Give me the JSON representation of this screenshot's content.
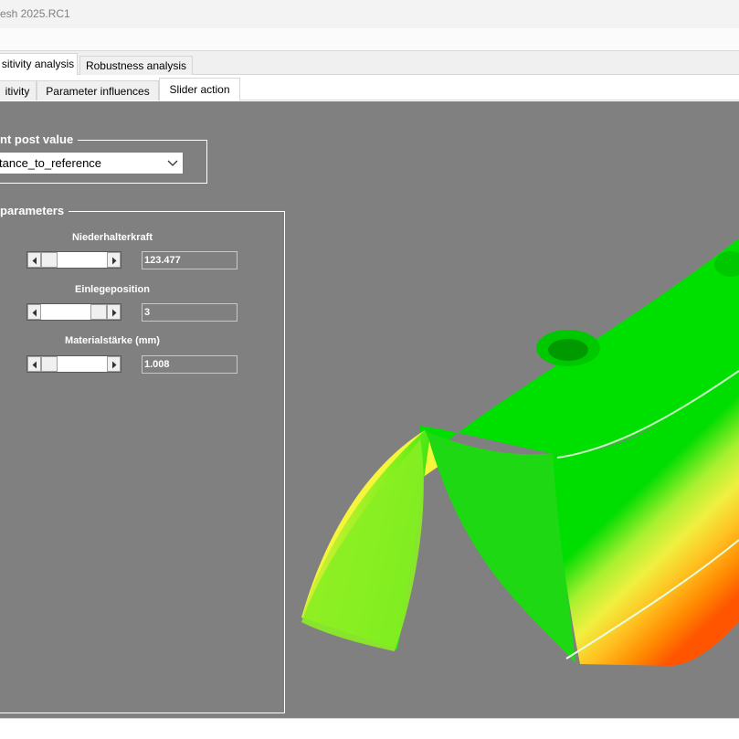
{
  "window": {
    "title": "esh 2025.RC1"
  },
  "tabs_row1": [
    {
      "label": "sitivity analysis",
      "active": true
    },
    {
      "label": "Robustness analysis",
      "active": false
    }
  ],
  "tabs_row2": [
    {
      "label": "itivity",
      "active": false
    },
    {
      "label": "Parameter influences",
      "active": false
    },
    {
      "label": "Slider action",
      "active": true
    }
  ],
  "post_value_group": {
    "title": "nt post value",
    "selected": "tance_to_reference"
  },
  "parameters_group": {
    "title": "parameters",
    "items": [
      {
        "label": "Niederhalterkraft",
        "value": "123.477",
        "position": 0.15
      },
      {
        "label": "Einlegeposition",
        "value": "3",
        "position": 0.8
      },
      {
        "label": "Materialstärke (mm)",
        "value": "1.008",
        "position": 0.1
      }
    ]
  },
  "colors": {
    "panel_background": "#808080",
    "mesh_green": "#00e000",
    "mesh_yellow_green": "#9ef02c",
    "mesh_yellow": "#f5f53c",
    "mesh_orange": "#ff8800"
  }
}
